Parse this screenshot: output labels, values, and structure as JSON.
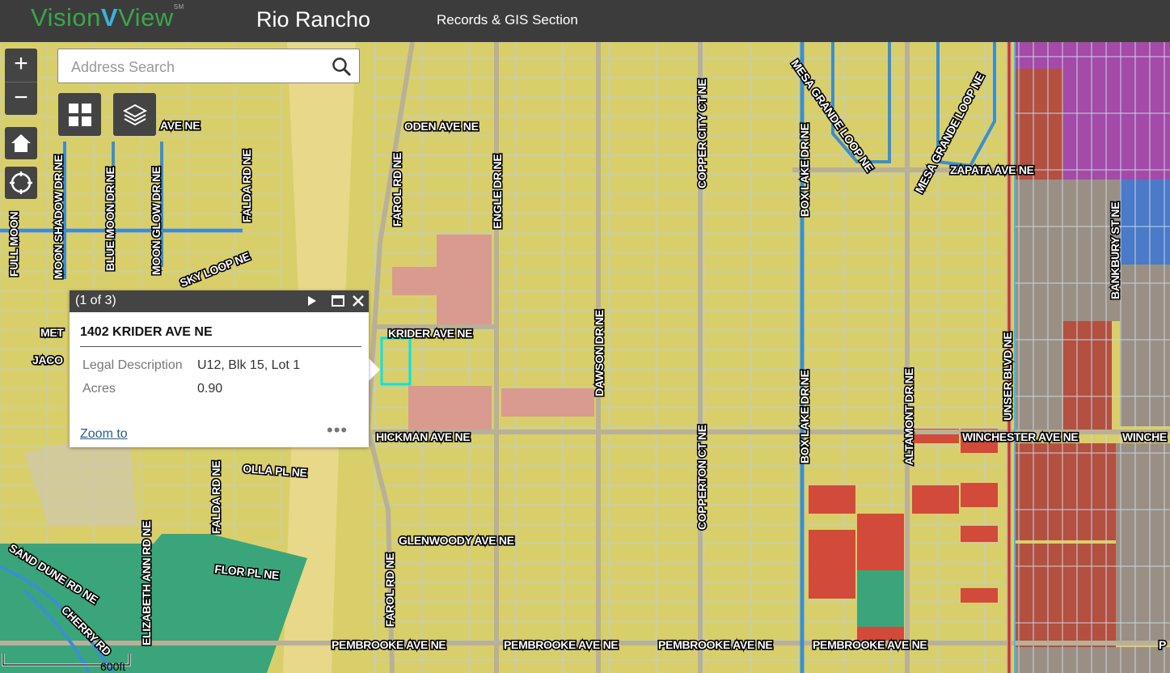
{
  "header": {
    "logo_vision": "Vision",
    "logo_v": "V",
    "logo_view": "View",
    "logo_sm": "SM",
    "city": "Rio Rancho",
    "section": "Records & GIS Section"
  },
  "controls": {
    "zoom_in_label": "+",
    "zoom_out_label": "−",
    "home_icon": "home-icon",
    "locate_icon": "locate-icon",
    "basemap_icon": "grid-icon",
    "layers_icon": "layers-icon"
  },
  "search": {
    "placeholder": "Address Search",
    "value": "",
    "icon": "search-icon"
  },
  "popup": {
    "count": "(1 of 3)",
    "title": "1402 KRIDER AVE NE",
    "fields": [
      {
        "label": "Legal Description",
        "value": "U12, Blk 15, Lot 1"
      },
      {
        "label": "Acres",
        "value": "0.90"
      }
    ],
    "zoom_to": "Zoom to",
    "more": "•••"
  },
  "scale": {
    "label": "600ft"
  },
  "map": {
    "colors": {
      "residential": "#d9cf6a",
      "parcel_line": "#b8cde0",
      "road": "#b9b098",
      "highlight_pink": "#d99a90",
      "commercial_red": "#d24a3a",
      "dark_red": "#b35040",
      "purple": "#a44aa8",
      "blue_zone": "#4a7ac8",
      "gray_zone": "#9a8f84",
      "green_zone": "#3aa57a",
      "selected": "#00e5e5"
    },
    "streets": {
      "oden": "ODEN AVE NE",
      "krider": "KRIDER AVE NE",
      "hickman": "HICKMAN AVE NE",
      "olla": "OLLA PL NE",
      "flor": "FLOR PL NE",
      "glenwoody": "GLENWOODY AVE NE",
      "pembrooke": "PEMBROOKE AVE NE",
      "farol": "FAROL RD NE",
      "engle": "ENGLE DR NE",
      "dawson": "DAWSON DR NE",
      "copper_city": "COPPER CITY CT NE",
      "copperton": "COPPERTON CT NE",
      "box_lake": "BOX LAKE DR NE",
      "altamont": "ALTAMONT DR NE",
      "unser": "UNSER BLVD NE",
      "bankbury": "BANKBURY ST NE",
      "mesa_grande": "MESA GRANDE LOOP NE",
      "zapata": "ZAPATA AVE NE",
      "winchester": "WINCHESTER AVE NE",
      "winch": "WINCHE",
      "falda": "FALDA RD NE",
      "full_moon": "FULL MOON",
      "moon_shadow": "MOON SHADOW DR NE",
      "blue_moon": "BLUE MOON DR NE",
      "moon_glow": "MOON GLOW DR NE",
      "sky_loop": "SKY LOOP NE",
      "ave_ne": "AVE NE",
      "met": "MET",
      "jaco": "JACO",
      "sand_dune": "SAND DUNE RD NE",
      "cherry": "CHERRY RD",
      "elizabeth_ann": "ELIZABETH ANN RD NE",
      "p": "P"
    }
  }
}
